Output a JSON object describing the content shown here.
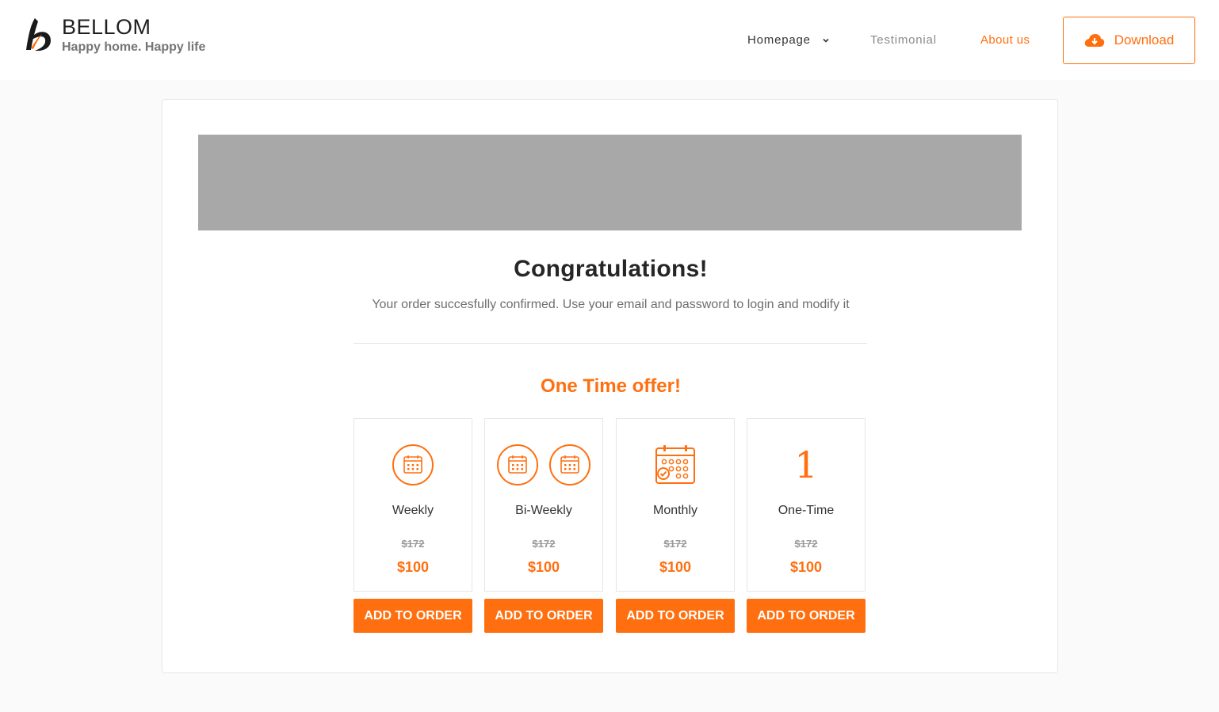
{
  "brand": {
    "name": "BELLOM",
    "tagline": "Happy home. Happy life"
  },
  "nav": {
    "items": [
      {
        "label": "Homepage",
        "has_dropdown": true
      },
      {
        "label": "Testimonial"
      },
      {
        "label": "About us",
        "active": true
      }
    ],
    "download_label": "Download"
  },
  "confirmation": {
    "title": "Congratulations!",
    "message": "Your order succesfully confirmed. Use your email and password to login and modify it"
  },
  "offer": {
    "title": "One Time offer!",
    "plans": [
      {
        "name": "Weekly",
        "old_price": "$172",
        "price": "$100",
        "icon": "calendar-icon",
        "button": "ADD TO ORDER"
      },
      {
        "name": "Bi-Weekly",
        "old_price": "$172",
        "price": "$100",
        "icon": "calendar-icon x2",
        "button": "ADD TO ORDER"
      },
      {
        "name": "Monthly",
        "old_price": "$172",
        "price": "$100",
        "icon": "monthly-calendar-icon",
        "button": "ADD TO ORDER"
      },
      {
        "name": "One-Time",
        "old_price": "$172",
        "price": "$100",
        "icon_text": "1",
        "button": "ADD TO ORDER"
      }
    ]
  },
  "colors": {
    "accent": "#ff6f0f",
    "banner_placeholder": "#a8a8a8",
    "page_bg": "#fafafa"
  }
}
